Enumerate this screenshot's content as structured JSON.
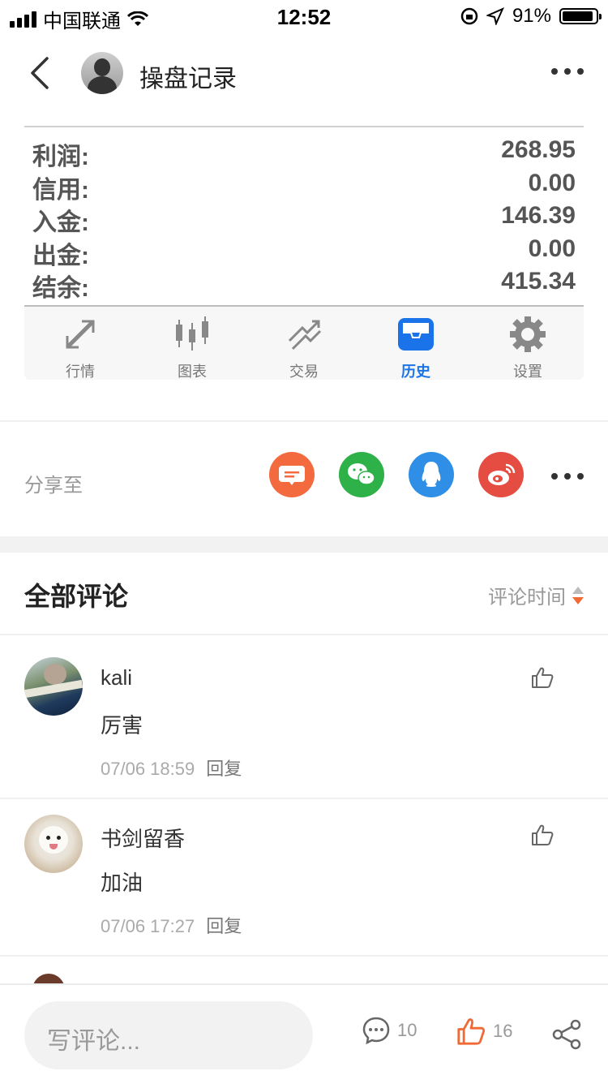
{
  "status_bar": {
    "carrier": "中国联通",
    "time": "12:52",
    "battery": "91%",
    "battery_level": 0.91
  },
  "nav": {
    "title": "操盘记录"
  },
  "account": {
    "rows": [
      {
        "label": "利润:",
        "value": "268.95"
      },
      {
        "label": "信用:",
        "value": "0.00"
      },
      {
        "label": "入金:",
        "value": "146.39"
      },
      {
        "label": "出金:",
        "value": "0.00"
      },
      {
        "label": "结余:",
        "value": "415.34"
      }
    ],
    "tabs": [
      {
        "label": "行情",
        "icon": "quotes-icon"
      },
      {
        "label": "图表",
        "icon": "chart-icon"
      },
      {
        "label": "交易",
        "icon": "trade-icon"
      },
      {
        "label": "历史",
        "icon": "history-icon",
        "active": true
      },
      {
        "label": "设置",
        "icon": "settings-icon"
      }
    ],
    "active_color": "#1a73e8"
  },
  "share": {
    "label": "分享至",
    "targets": [
      {
        "icon": "sms-icon",
        "color": "#f26a3d"
      },
      {
        "icon": "wechat-icon",
        "color": "#2fb14a"
      },
      {
        "icon": "qq-icon",
        "color": "#2f8ee6"
      },
      {
        "icon": "weibo-icon",
        "color": "#e54d42"
      }
    ]
  },
  "comments": {
    "title": "全部评论",
    "sort_label": "评论时间",
    "items": [
      {
        "name": "kali",
        "text": "厉害",
        "time": "07/06 18:59",
        "reply": "回复"
      },
      {
        "name": "书剑留香",
        "text": "加油",
        "time": "07/06 17:27",
        "reply": "回复"
      }
    ]
  },
  "bottom_bar": {
    "placeholder": "写评论...",
    "comment_count": "10",
    "like_count": "16",
    "accent": "#f06a35"
  }
}
